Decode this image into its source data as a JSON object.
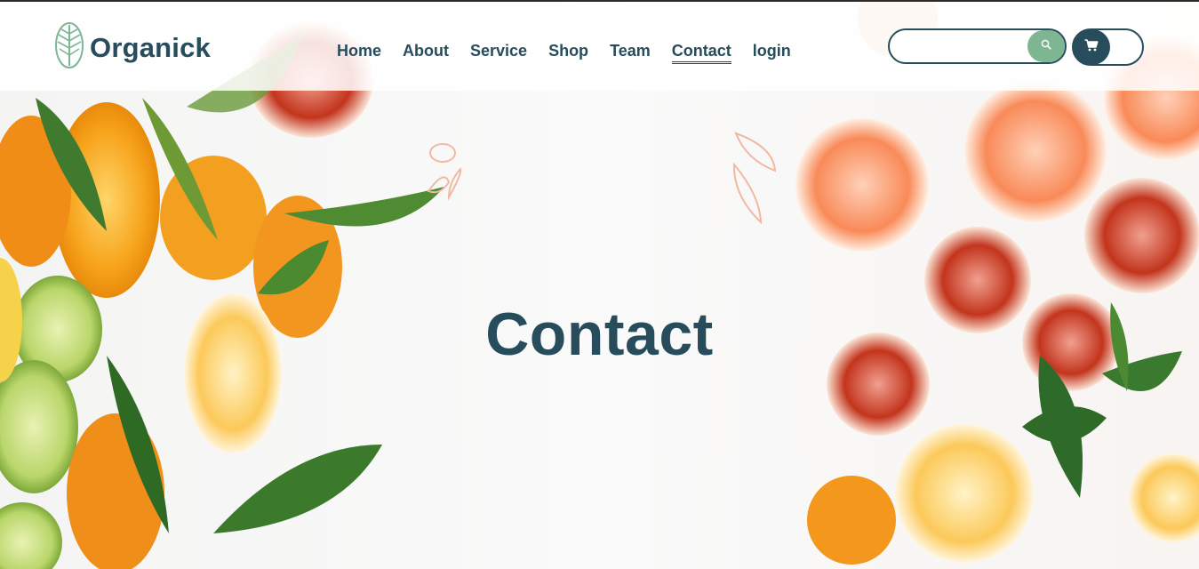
{
  "header": {
    "brand": "Organick",
    "nav": [
      {
        "label": "Home",
        "active": false
      },
      {
        "label": "About",
        "active": false
      },
      {
        "label": "Service",
        "active": false
      },
      {
        "label": "Shop",
        "active": false
      },
      {
        "label": "Team",
        "active": false
      },
      {
        "label": "Contact",
        "active": true
      },
      {
        "label": "login",
        "active": false
      }
    ],
    "search": {
      "placeholder": "",
      "value": "",
      "icon": "search-icon"
    },
    "cart": {
      "icon": "cart-icon"
    }
  },
  "hero": {
    "title": "Contact",
    "background": "citrus-fruit-photo"
  },
  "colors": {
    "primary": "#274c5b",
    "accent": "#7eb693"
  }
}
